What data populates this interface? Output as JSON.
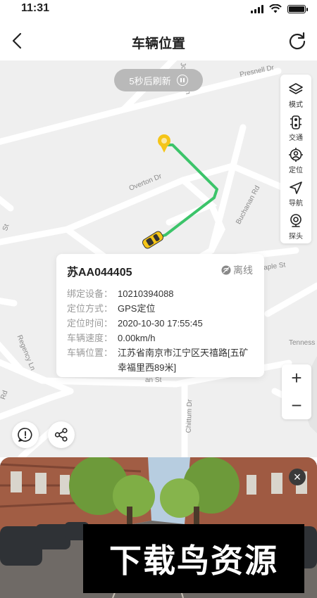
{
  "status_bar": {
    "time": "11:31"
  },
  "header": {
    "title": "车辆位置"
  },
  "map": {
    "refresh_pill": {
      "text": "5秒后刷新"
    },
    "streets": [
      "Overton Dr",
      "Buchanan Rd",
      "Presnell Dr",
      "Jouglin Ln",
      "Regency Ln",
      "Chittum Dr",
      "Tenness",
      "Maple St",
      "Rd",
      "an St",
      "St"
    ],
    "tools": [
      {
        "label": "模式",
        "icon": "layers-icon"
      },
      {
        "label": "交通",
        "icon": "traffic-light-icon"
      },
      {
        "label": "定位",
        "icon": "locate-icon"
      },
      {
        "label": "导航",
        "icon": "navigation-icon"
      },
      {
        "label": "探头",
        "icon": "camera-icon"
      }
    ],
    "route_color": "#3cc46a",
    "pin_color": "#f5c518"
  },
  "vehicle": {
    "plate": "苏AA044405",
    "status": "离线",
    "fields": [
      {
        "key": "绑定设备：",
        "value": "10210394088"
      },
      {
        "key": "定位方式：",
        "value": "GPS定位"
      },
      {
        "key": "定位时间：",
        "value": "2020-10-30 17:55:45"
      },
      {
        "key": "车辆速度：",
        "value": "0.00km/h"
      },
      {
        "key": "车辆位置：",
        "value": "江苏省南京市江宁区天禧路[五矿幸福里西89米]"
      }
    ]
  },
  "zoom": {
    "plus": "+",
    "minus": "−"
  },
  "street_view": {
    "close": "×",
    "watermark": "下载鸟资源"
  }
}
